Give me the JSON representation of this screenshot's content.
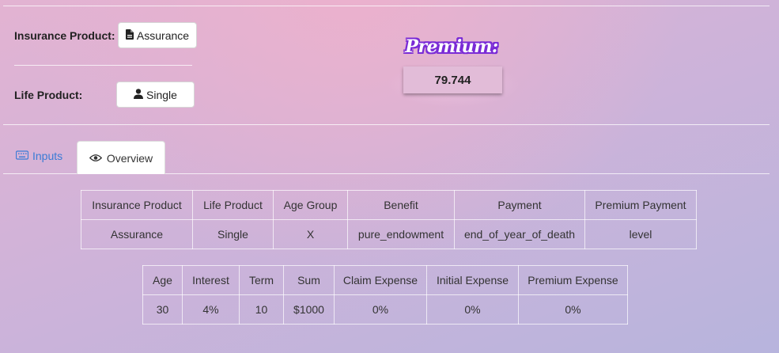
{
  "insurance_product": {
    "label": "Insurance Product:",
    "value": "Assurance"
  },
  "life_product": {
    "label": "Life Product:",
    "value": "Single"
  },
  "premium": {
    "title": "Premium:",
    "value": "79.744"
  },
  "tabs": [
    {
      "label": "Inputs",
      "icon": "keyboard-icon",
      "active": false
    },
    {
      "label": "Overview",
      "icon": "eye-icon",
      "active": true
    }
  ],
  "overview_table": {
    "headers": [
      "Insurance Product",
      "Life Product",
      "Age Group",
      "Benefit",
      "Payment",
      "Premium Payment"
    ],
    "row": [
      "Assurance",
      "Single",
      "X",
      "pure_endowment",
      "end_of_year_of_death",
      "level"
    ]
  },
  "params_table": {
    "headers": [
      "Age",
      "Interest",
      "Term",
      "Sum",
      "Claim Expense",
      "Initial Expense",
      "Premium Expense"
    ],
    "row": [
      "30",
      "4%",
      "10",
      "$1000",
      "0%",
      "0%",
      "0%"
    ]
  }
}
